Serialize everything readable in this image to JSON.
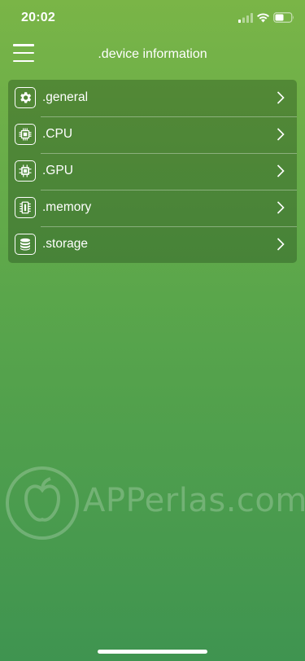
{
  "status_bar": {
    "time": "20:02",
    "icons": [
      "signal-icon",
      "wifi-icon",
      "battery-icon"
    ]
  },
  "nav": {
    "title": ".device information",
    "menu_icon": "hamburger-icon"
  },
  "menu": {
    "items": [
      {
        "label": ".general",
        "icon": "gear-icon"
      },
      {
        "label": ".CPU",
        "icon": "cpu-icon"
      },
      {
        "label": ".GPU",
        "icon": "gpu-icon"
      },
      {
        "label": ".memory",
        "icon": "memory-icon"
      },
      {
        "label": ".storage",
        "icon": "storage-icon"
      }
    ]
  },
  "watermark": {
    "text": "APPerlas.com"
  },
  "colors": {
    "background_top": "#7ab547",
    "background_bottom": "#3f9450",
    "text": "#ffffff"
  }
}
